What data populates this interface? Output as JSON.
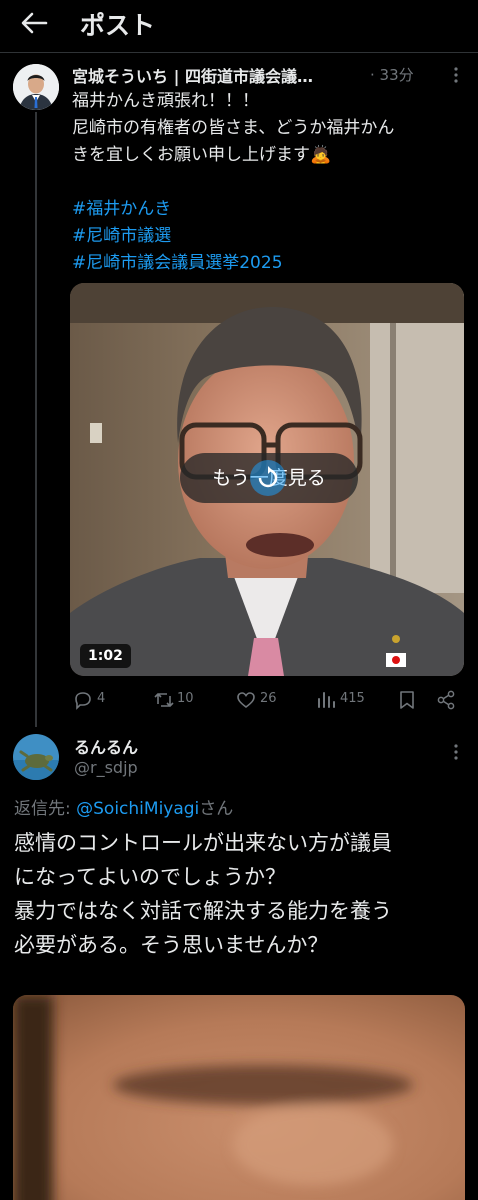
{
  "header": {
    "title": "ポスト"
  },
  "post": {
    "author_name": "宮城そういち | 四街道市議会議…",
    "time": "· 33分",
    "text_lines": [
      "福井かんき頑張れ！！！",
      "尼崎市の有権者の皆さま、どうか福井かん",
      "きを宜しくお願い申し上げます🙇"
    ],
    "hashtags": [
      "#福井かんき",
      "#尼崎市議選",
      "#尼崎市議会議員選挙2025"
    ],
    "media": {
      "replay_label": "もう一度見る",
      "duration": "1:02"
    },
    "actions": {
      "replies": "4",
      "reposts": "10",
      "likes": "26",
      "views": "415"
    }
  },
  "reply": {
    "author_name": "るんるん",
    "handle": "@r_sdjp",
    "reply_to_prefix": "返信先: ",
    "reply_to_mention": "@SoichiMiyagi",
    "reply_to_suffix": "さん",
    "text_lines": [
      "感情のコントロールが出来ない方が議員",
      "になってよいのでしょうか？",
      "暴力ではなく対話で解決する能力を養う",
      "必要がある。そう思いませんか？"
    ]
  },
  "colors": {
    "accent": "#1d9bf0",
    "muted": "#71767b",
    "background": "#000000"
  }
}
